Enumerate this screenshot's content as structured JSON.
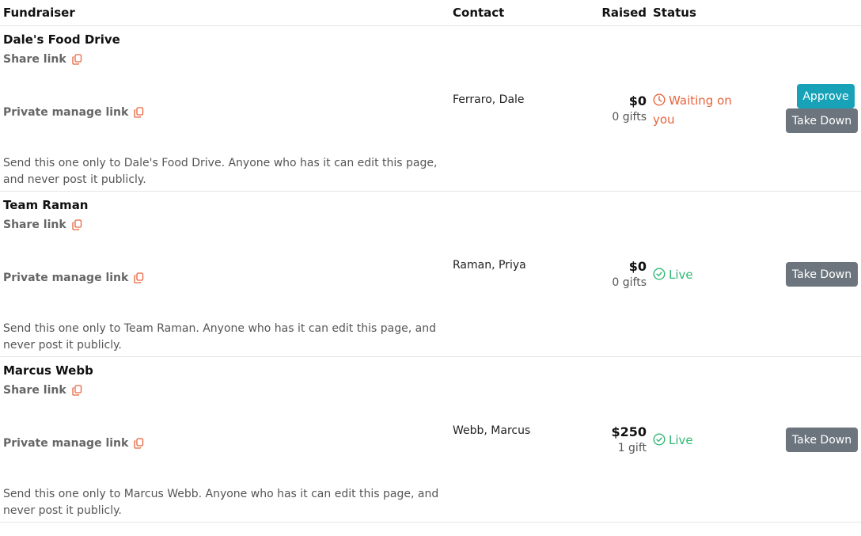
{
  "columns": {
    "fundraiser": "Fundraiser",
    "contact": "Contact",
    "raised": "Raised",
    "status": "Status"
  },
  "colors": {
    "waiting": "#e8643c",
    "live": "#2fb873",
    "approve_button": "#17a2b8",
    "take_down_button": "#6c757d"
  },
  "rows": [
    {
      "name": "Dale's Food Drive",
      "share_link_label": "Share link",
      "private_link_label": "Private manage link",
      "note": "Send this one only to Dale's Food Drive. Anyone who has it can edit this page, and never post it publicly.",
      "contact": "Ferraro, Dale",
      "raised": "$0",
      "gifts": "0 gifts",
      "status": "Waiting on you",
      "status_icon": "clock-icon",
      "approve_label": "Approve",
      "take_down_label": "Take Down"
    },
    {
      "name": "Team Raman",
      "share_link_label": "Share link",
      "private_link_label": "Private manage link",
      "note": "Send this one only to Team Raman. Anyone who has it can edit this page, and never post it publicly.",
      "contact": "Raman, Priya",
      "raised": "$0",
      "gifts": "0 gifts",
      "status": "Live",
      "status_icon": "check-circle-icon",
      "take_down_label": "Take Down"
    },
    {
      "name": "Marcus Webb",
      "share_link_label": "Share link",
      "private_link_label": "Private manage link",
      "note": "Send this one only to Marcus Webb. Anyone who has it can edit this page, and never post it publicly.",
      "contact": "Webb, Marcus",
      "raised": "$250",
      "gifts": "1 gift",
      "status": "Live",
      "status_icon": "check-circle-icon",
      "take_down_label": "Take Down"
    }
  ]
}
